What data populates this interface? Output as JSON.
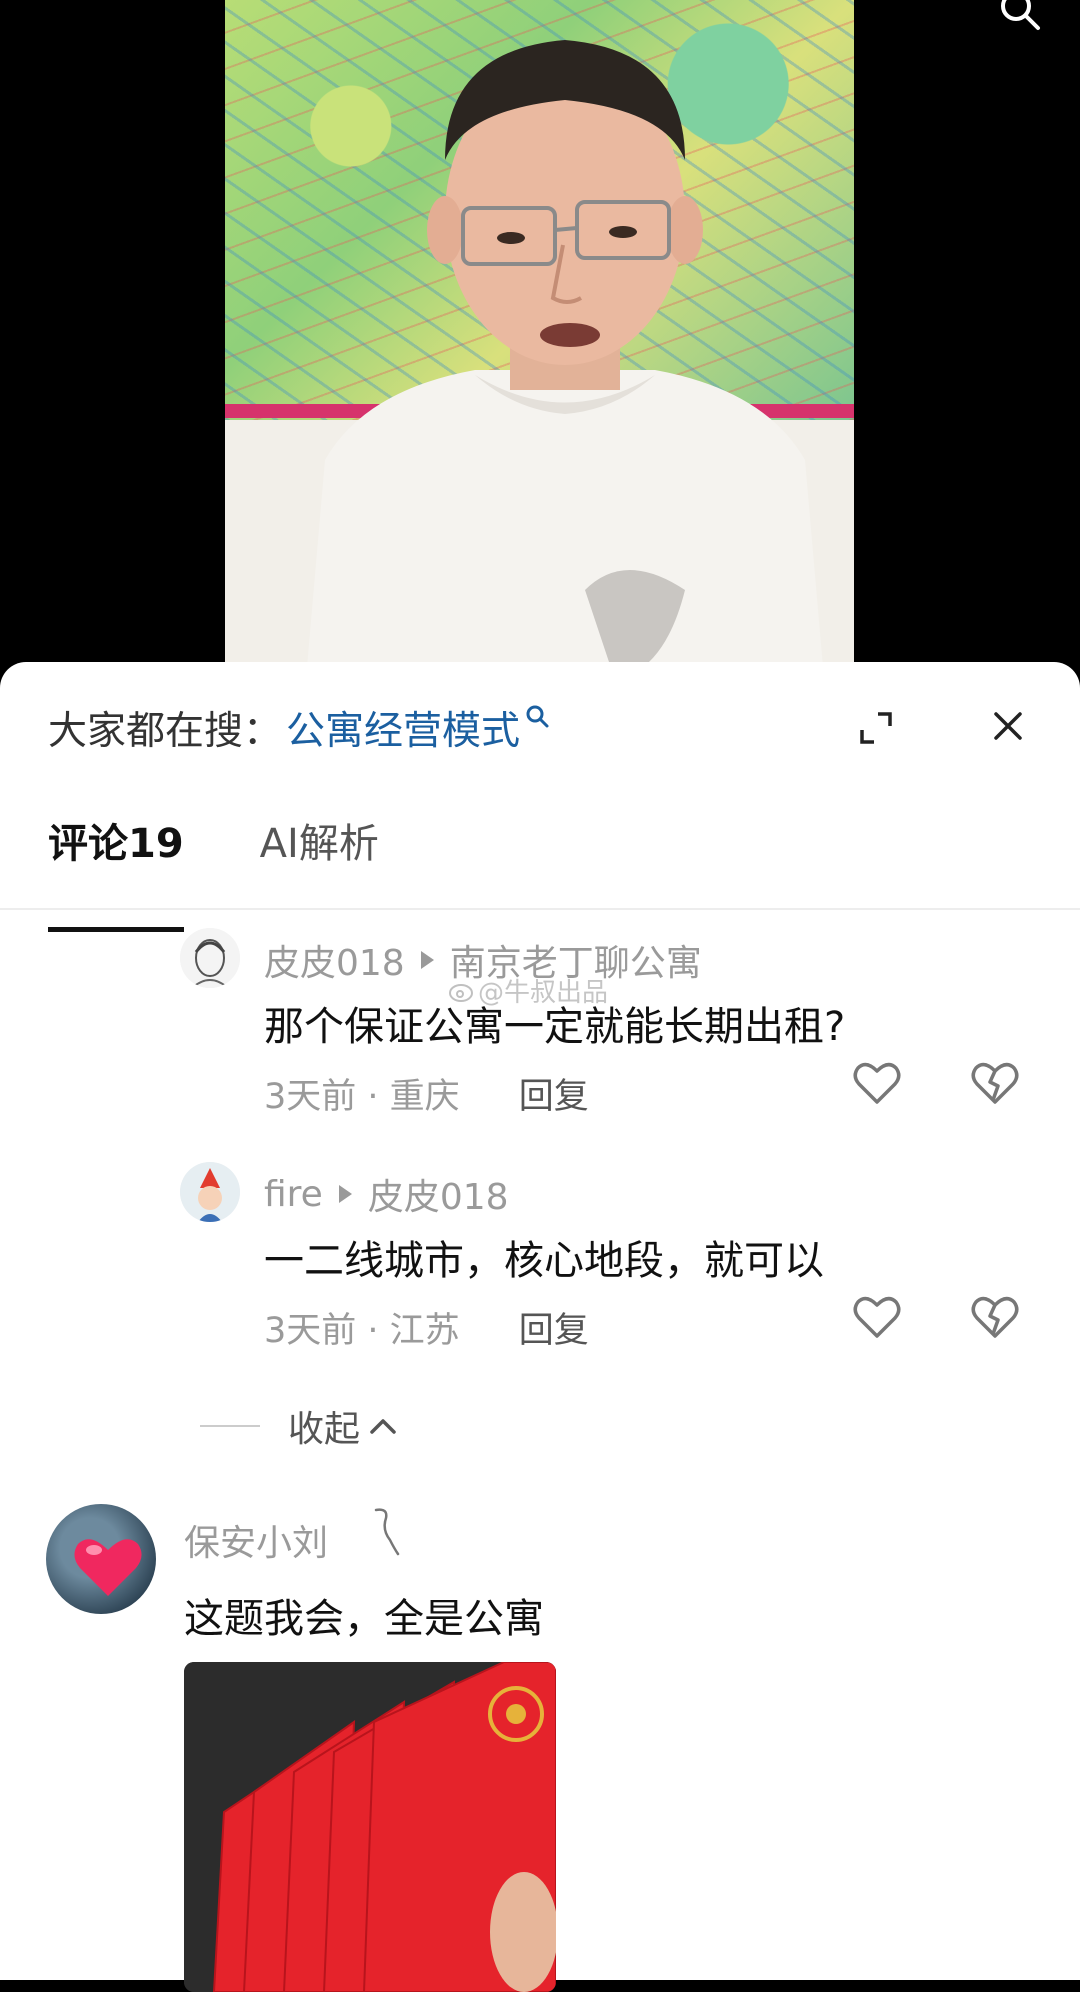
{
  "hot_search": {
    "prefix": "大家都在搜：",
    "term": "公寓经营模式",
    "term_icon": "search-icon"
  },
  "tabs": [
    {
      "label": "评论19",
      "active": true
    },
    {
      "label": "AI解析",
      "active": false
    }
  ],
  "replies": [
    {
      "user": "皮皮018",
      "reply_to": "南京老丁聊公寓",
      "text": "那个保证公寓一定就能长期出租?",
      "time_location": "3天前 · 重庆",
      "reply_label": "回复"
    },
    {
      "user": "fire",
      "reply_to": "皮皮018",
      "text": "一二线城市，核心地段，就可以",
      "time_location": "3天前 · 江苏",
      "reply_label": "回复"
    }
  ],
  "collapse_label": "收起",
  "watermark": "@牛叔出品",
  "top_comment": {
    "user": "保安小刘",
    "text": "这题我会，全是公寓"
  },
  "colors": {
    "hot_term": "#1b5fa0",
    "map_border": "#d6336c"
  }
}
